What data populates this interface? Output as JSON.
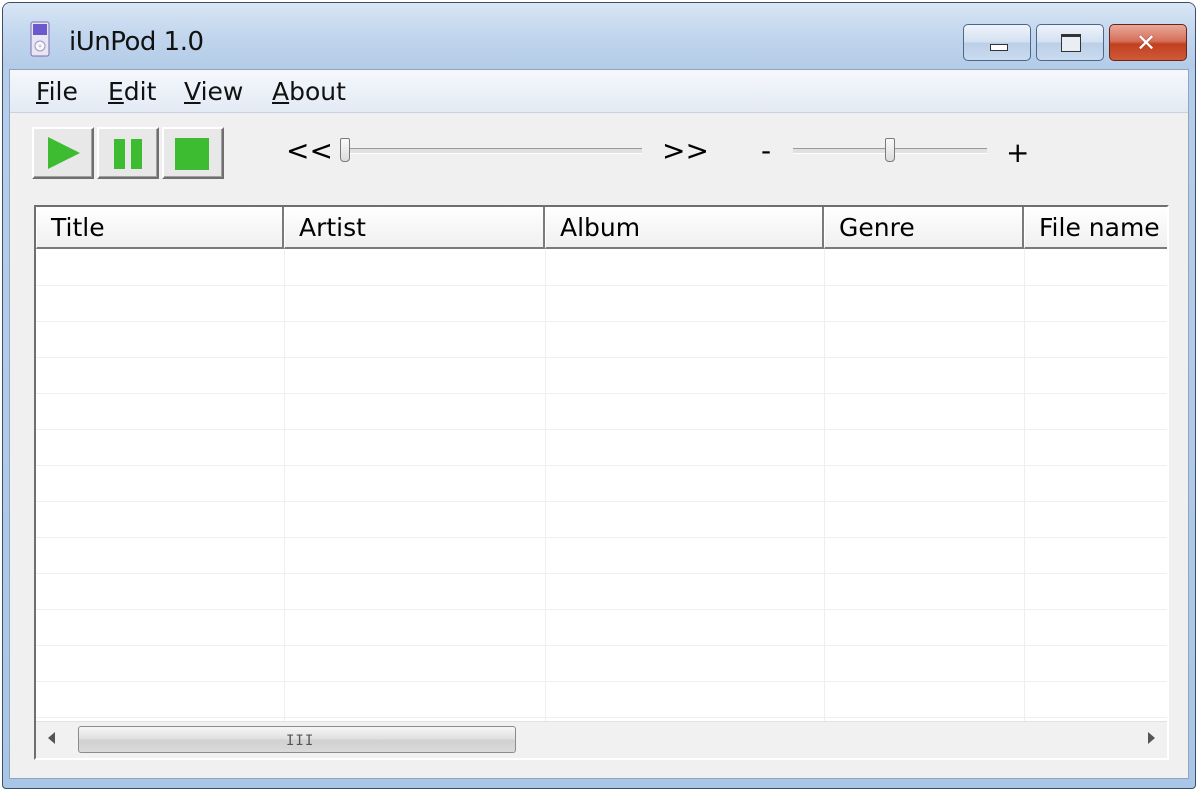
{
  "window": {
    "title": "iUnPod 1.0",
    "icon": "ipod-icon"
  },
  "caption_buttons": [
    "minimize-icon",
    "maximize-icon",
    "close-icon"
  ],
  "close_glyph": "✕",
  "menu": {
    "items": [
      {
        "label": "File",
        "accel": "F",
        "rest": "ile"
      },
      {
        "label": "Edit",
        "accel": "E",
        "rest": "dit"
      },
      {
        "label": "View",
        "accel": "V",
        "rest": "iew"
      },
      {
        "label": "About",
        "accel": "A",
        "rest": "bout"
      }
    ]
  },
  "toolbar": {
    "buttons": [
      "play-icon",
      "pause-icon",
      "stop-icon"
    ],
    "seek": {
      "left_label": "<<",
      "right_label": ">>",
      "position": 0.0
    },
    "volume": {
      "minus_label": "-",
      "plus_label": "+",
      "level": 0.5
    }
  },
  "list": {
    "columns": [
      "Title",
      "Artist",
      "Album",
      "Genre",
      "File name"
    ],
    "rows": []
  },
  "colors": {
    "accent_green": "#3dbb31",
    "close_red": "#c2401f"
  },
  "scrollbar": {
    "grip": "III"
  }
}
